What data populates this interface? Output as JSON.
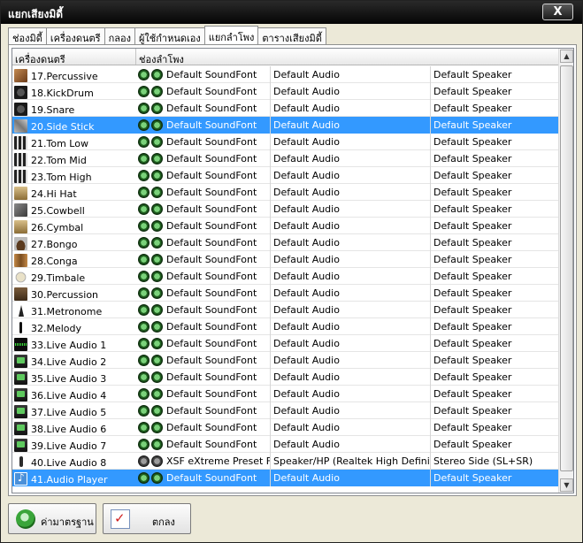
{
  "window": {
    "title": "แยกเสียงมิดี้",
    "close_label": "X"
  },
  "tabs": [
    {
      "label": "ช่องมิดี้",
      "active": false
    },
    {
      "label": "เครื่องดนตรี",
      "active": false
    },
    {
      "label": "กลอง",
      "active": false
    },
    {
      "label": "ผู้ใช้กำหนดเอง",
      "active": false
    },
    {
      "label": "แยกลำโพง",
      "active": true
    },
    {
      "label": "ตารางเสียงมิดี้",
      "active": false
    }
  ],
  "table": {
    "columns": [
      "เครื่องดนตรี",
      "ช่องลำโพง"
    ],
    "rows": [
      {
        "name": "17.Percussive",
        "icon": "percussive-icon",
        "cls": "ico-perc",
        "soundfont": "Default SoundFont",
        "device": "Default Audio",
        "speaker": "Default Speaker",
        "led": "on",
        "selected": false
      },
      {
        "name": "18.KickDrum",
        "icon": "kick-drum-icon",
        "cls": "ico-drum",
        "soundfont": "Default SoundFont",
        "device": "Default Audio",
        "speaker": "Default Speaker",
        "led": "on",
        "selected": false
      },
      {
        "name": "19.Snare",
        "icon": "snare-icon",
        "cls": "ico-drum",
        "soundfont": "Default SoundFont",
        "device": "Default Audio",
        "speaker": "Default Speaker",
        "led": "on",
        "selected": false
      },
      {
        "name": "20.Side Stick",
        "icon": "side-stick-icon",
        "cls": "ico-stick",
        "soundfont": "Default SoundFont",
        "device": "Default Audio",
        "speaker": "Default Speaker",
        "led": "on",
        "selected": true
      },
      {
        "name": "21.Tom Low",
        "icon": "tom-icon",
        "cls": "ico-tom",
        "soundfont": "Default SoundFont",
        "device": "Default Audio",
        "speaker": "Default Speaker",
        "led": "on",
        "selected": false
      },
      {
        "name": "22.Tom Mid",
        "icon": "tom-icon",
        "cls": "ico-tom",
        "soundfont": "Default SoundFont",
        "device": "Default Audio",
        "speaker": "Default Speaker",
        "led": "on",
        "selected": false
      },
      {
        "name": "23.Tom High",
        "icon": "tom-icon",
        "cls": "ico-tom",
        "soundfont": "Default SoundFont",
        "device": "Default Audio",
        "speaker": "Default Speaker",
        "led": "on",
        "selected": false
      },
      {
        "name": "24.Hi Hat",
        "icon": "hi-hat-icon",
        "cls": "ico-tool",
        "soundfont": "Default SoundFont",
        "device": "Default Audio",
        "speaker": "Default Speaker",
        "led": "on",
        "selected": false
      },
      {
        "name": "25.Cowbell",
        "icon": "cowbell-icon",
        "cls": "ico-bell",
        "soundfont": "Default SoundFont",
        "device": "Default Audio",
        "speaker": "Default Speaker",
        "led": "on",
        "selected": false
      },
      {
        "name": "26.Cymbal",
        "icon": "cymbal-icon",
        "cls": "ico-tool",
        "soundfont": "Default SoundFont",
        "device": "Default Audio",
        "speaker": "Default Speaker",
        "led": "on",
        "selected": false
      },
      {
        "name": "27.Bongo",
        "icon": "bongo-icon",
        "cls": "ico-bongo",
        "soundfont": "Default SoundFont",
        "device": "Default Audio",
        "speaker": "Default Speaker",
        "led": "on",
        "selected": false
      },
      {
        "name": "28.Conga",
        "icon": "conga-icon",
        "cls": "ico-conga",
        "soundfont": "Default SoundFont",
        "device": "Default Audio",
        "speaker": "Default Speaker",
        "led": "on",
        "selected": false
      },
      {
        "name": "29.Timbale",
        "icon": "timbale-icon",
        "cls": "ico-timb",
        "soundfont": "Default SoundFont",
        "device": "Default Audio",
        "speaker": "Default Speaker",
        "led": "on",
        "selected": false
      },
      {
        "name": "30.Percussion",
        "icon": "percussion-icon",
        "cls": "ico-person",
        "soundfont": "Default SoundFont",
        "device": "Default Audio",
        "speaker": "Default Speaker",
        "led": "on",
        "selected": false
      },
      {
        "name": "31.Metronome",
        "icon": "metronome-icon",
        "cls": "ico-metro",
        "soundfont": "Default SoundFont",
        "device": "Default Audio",
        "speaker": "Default Speaker",
        "led": "on",
        "selected": false
      },
      {
        "name": "32.Melody",
        "icon": "microphone-icon",
        "cls": "ico-mic",
        "soundfont": "Default SoundFont",
        "device": "Default Audio",
        "speaker": "Default Speaker",
        "led": "on",
        "selected": false
      },
      {
        "name": "33.Live Audio 1",
        "icon": "waveform-icon",
        "cls": "ico-wave",
        "soundfont": "Default SoundFont",
        "device": "Default Audio",
        "speaker": "Default Speaker",
        "led": "on",
        "selected": false
      },
      {
        "name": "34.Live Audio 2",
        "icon": "live-audio-icon",
        "cls": "ico-live",
        "soundfont": "Default SoundFont",
        "device": "Default Audio",
        "speaker": "Default Speaker",
        "led": "on",
        "selected": false
      },
      {
        "name": "35.Live Audio 3",
        "icon": "live-audio-icon",
        "cls": "ico-live",
        "soundfont": "Default SoundFont",
        "device": "Default Audio",
        "speaker": "Default Speaker",
        "led": "on",
        "selected": false
      },
      {
        "name": "36.Live Audio 4",
        "icon": "live-audio-icon",
        "cls": "ico-live",
        "soundfont": "Default SoundFont",
        "device": "Default Audio",
        "speaker": "Default Speaker",
        "led": "on",
        "selected": false
      },
      {
        "name": "37.Live Audio 5",
        "icon": "live-audio-icon",
        "cls": "ico-live",
        "soundfont": "Default SoundFont",
        "device": "Default Audio",
        "speaker": "Default Speaker",
        "led": "on",
        "selected": false
      },
      {
        "name": "38.Live Audio 6",
        "icon": "live-audio-icon",
        "cls": "ico-live",
        "soundfont": "Default SoundFont",
        "device": "Default Audio",
        "speaker": "Default Speaker",
        "led": "on",
        "selected": false
      },
      {
        "name": "39.Live Audio 7",
        "icon": "live-audio-icon",
        "cls": "ico-live",
        "soundfont": "Default SoundFont",
        "device": "Default Audio",
        "speaker": "Default Speaker",
        "led": "on",
        "selected": false
      },
      {
        "name": "40.Live Audio 8",
        "icon": "microphone-icon",
        "cls": "ico-mic2",
        "soundfont": "XSF eXtreme Preset Ful",
        "device": "Speaker/HP (Realtek High Definition A",
        "speaker": "Stereo Side (SL+SR)",
        "led": "off",
        "selected": false
      },
      {
        "name": "41.Audio Player",
        "icon": "music-note-icon",
        "cls": "ico-note",
        "soundfont": "Default SoundFont",
        "device": "Default Audio",
        "speaker": "Default Speaker",
        "led": "on",
        "selected": true
      }
    ]
  },
  "footer": {
    "default_label": "ค่ามาตรฐาน",
    "ok_label": "ตกลง"
  }
}
